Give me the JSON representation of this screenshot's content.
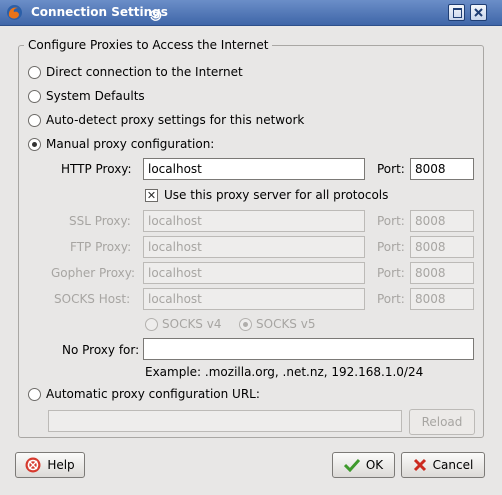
{
  "window": {
    "title": "Connection Settings"
  },
  "group": {
    "title": "Configure Proxies to Access the Internet"
  },
  "options": {
    "direct": "Direct connection to the Internet",
    "system": "System Defaults",
    "autodetect": "Auto-detect proxy settings for this network",
    "manual": "Manual proxy configuration:",
    "auto_url": "Automatic proxy configuration URL:"
  },
  "manual": {
    "http_label": "HTTP Proxy:",
    "http_value": "localhost",
    "http_port_label": "Port:",
    "http_port": "8008",
    "same_proxy_label": "Use this proxy server for all protocols",
    "same_proxy_checked": true,
    "ssl_label": "SSL Proxy:",
    "ssl_value": "localhost",
    "ssl_port_label": "Port:",
    "ssl_port": "8008",
    "ftp_label": "FTP Proxy:",
    "ftp_value": "localhost",
    "ftp_port_label": "Port:",
    "ftp_port": "8008",
    "gopher_label": "Gopher Proxy:",
    "gopher_value": "localhost",
    "gopher_port_label": "Port:",
    "gopher_port": "8008",
    "socks_label": "SOCKS Host:",
    "socks_value": "localhost",
    "socks_port_label": "Port:",
    "socks_port": "8008",
    "socks_v4": "SOCKS v4",
    "socks_v5": "SOCKS v5",
    "no_proxy_label": "No Proxy for:",
    "no_proxy_value": "",
    "example": "Example: .mozilla.org, .net.nz, 192.168.1.0/24"
  },
  "auto": {
    "url_value": "",
    "reload": "Reload"
  },
  "buttons": {
    "help": "Help",
    "ok": "OK",
    "cancel": "Cancel"
  },
  "colors": {
    "titlebar": "#4a72b5",
    "help_icon": "#d63a2e",
    "ok_icon": "#3e9a2c",
    "cancel_icon": "#cc2a1f"
  }
}
